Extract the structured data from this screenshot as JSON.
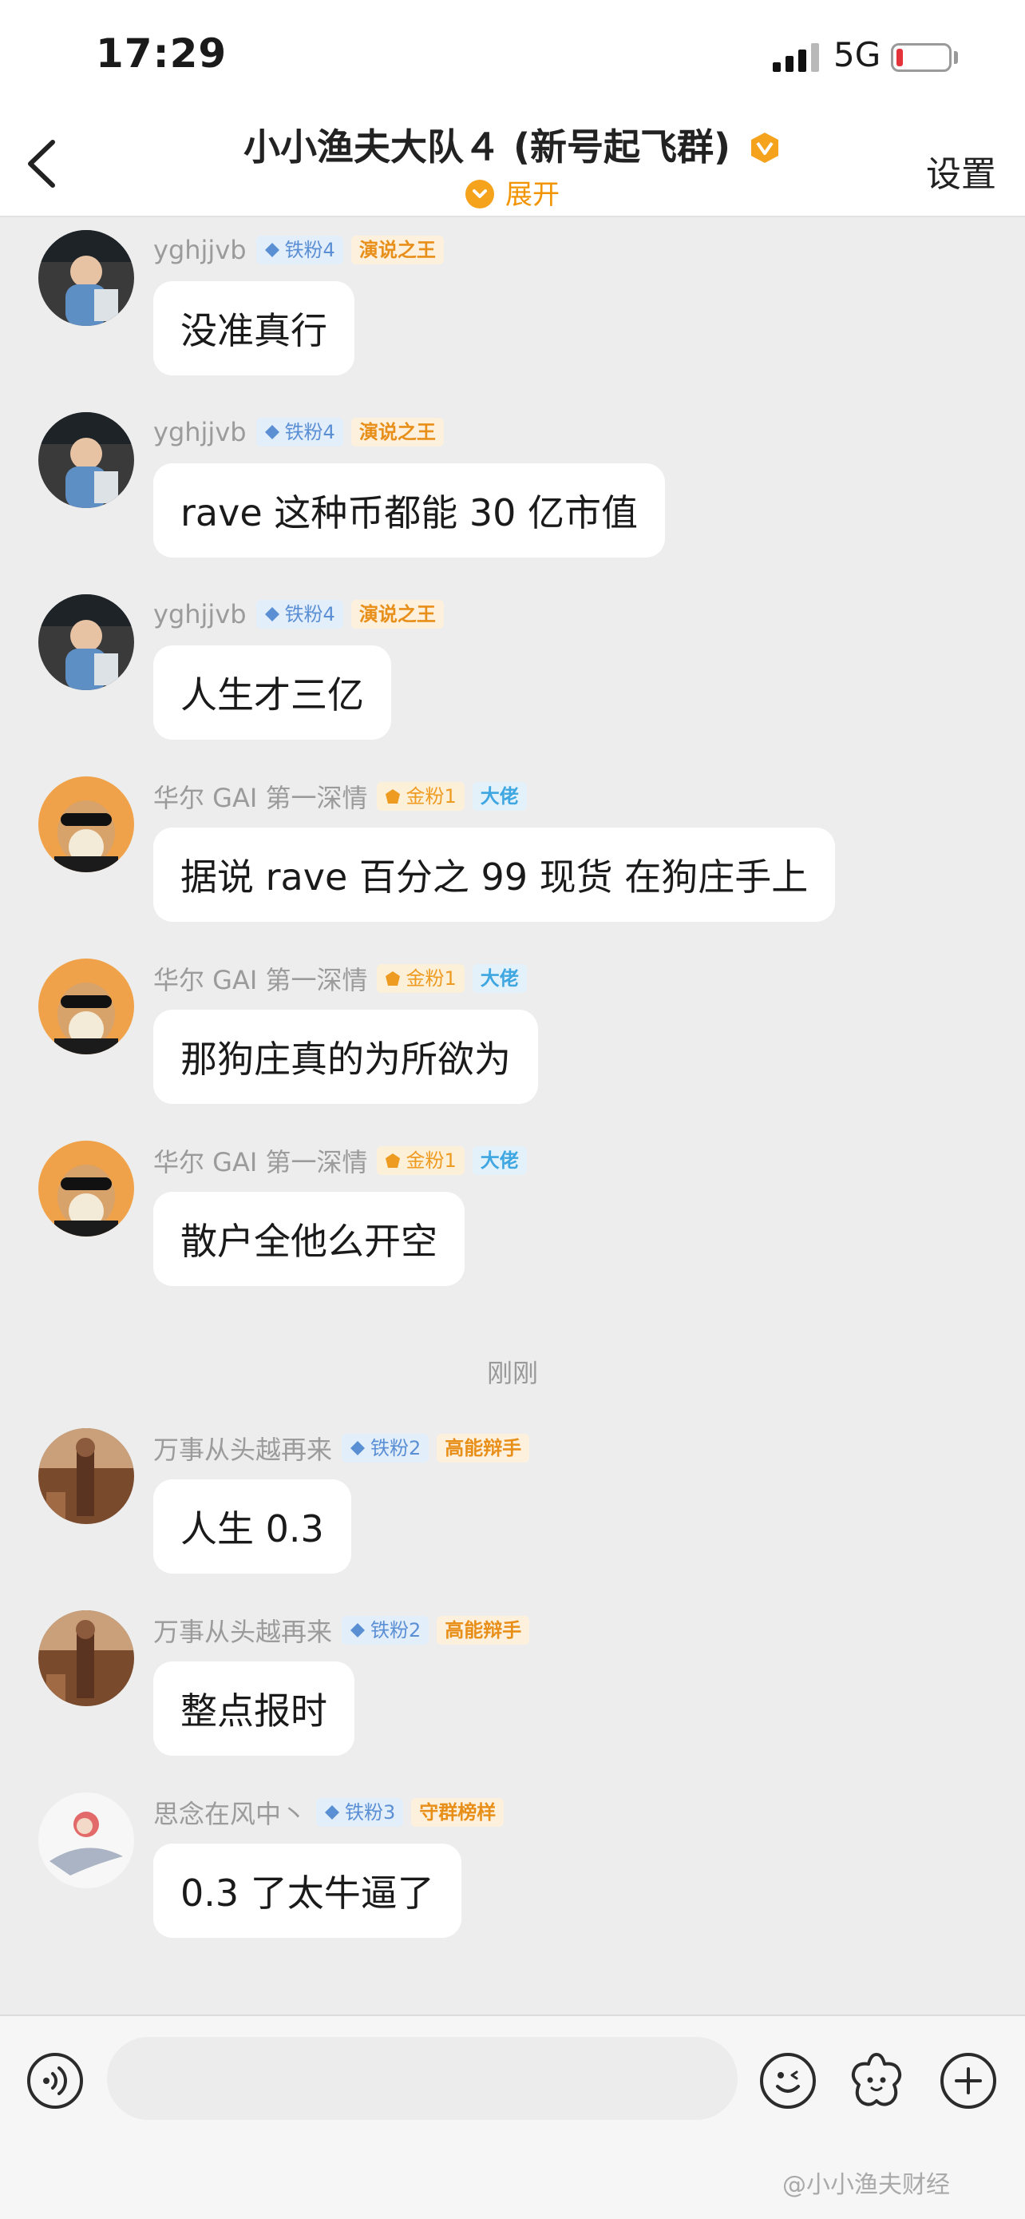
{
  "status_bar": {
    "time": "17:29",
    "network": "5G"
  },
  "header": {
    "title": "小小渔夫大队４ (新号起飞群)",
    "expand_label": "展开",
    "settings_label": "设置"
  },
  "messages": [
    {
      "user": "yghjjvb",
      "fan_badge": "铁粉4",
      "title_badge": "演说之王",
      "text": "没准真行"
    },
    {
      "user": "yghjjvb",
      "fan_badge": "铁粉4",
      "title_badge": "演说之王",
      "text": "rave 这种币都能 30 亿市值"
    },
    {
      "user": "yghjjvb",
      "fan_badge": "铁粉4",
      "title_badge": "演说之王",
      "text": "人生才三亿"
    },
    {
      "user": "华尔 GAI 第一深情",
      "fan_badge": "金粉1",
      "title_badge": "大佬",
      "text": "据说 rave 百分之 99 现货 在狗庄手上"
    },
    {
      "user": "华尔 GAI 第一深情",
      "fan_badge": "金粉1",
      "title_badge": "大佬",
      "text": "那狗庄真的为所欲为"
    },
    {
      "user": "华尔 GAI 第一深情",
      "fan_badge": "金粉1",
      "title_badge": "大佬",
      "text": "散户全他么开空"
    },
    {
      "user": "万事从头越再来",
      "fan_badge": "铁粉2",
      "title_badge": "高能辩手",
      "text": "人生 0.3"
    },
    {
      "user": "万事从头越再来",
      "fan_badge": "铁粉2",
      "title_badge": "高能辩手",
      "text": "整点报时"
    },
    {
      "user": "思念在风中丶",
      "fan_badge": "铁粉3",
      "title_badge": "守群榜样",
      "text": "0.3 了太牛逼了"
    }
  ],
  "time_separator": "刚刚",
  "input": {
    "value": "",
    "placeholder": ""
  },
  "watermark": "@小小渔夫财经",
  "colors": {
    "accent": "#f5a21c",
    "iron_badge": "#5b8fd4",
    "gold_badge": "#ee9b22",
    "background": "#ededed"
  },
  "icons": [
    "back-icon",
    "vip-icon",
    "expand-icon",
    "voice-icon",
    "emoji-icon",
    "sticker-icon",
    "plus-icon"
  ]
}
